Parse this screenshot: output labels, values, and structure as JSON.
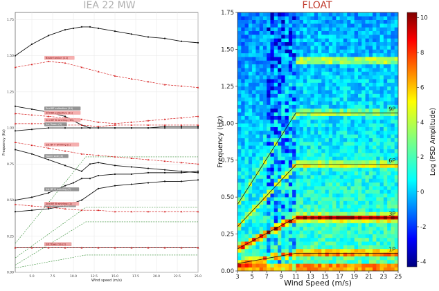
{
  "left_title": "IEA 22 MW",
  "right_title": "FLOAT",
  "left_title_color": "#b0b0b0",
  "right_title_color": "#c0392b",
  "left": {
    "xlabel": "Wind speed (m/s)",
    "ylabel": "Frequency (Hz)",
    "xlim": [
      3,
      25
    ],
    "ylim": [
      0.0,
      1.8
    ],
    "xticks": [
      "5.0",
      "7.5",
      "10.0",
      "12.5",
      "15.0",
      "17.5",
      "20.0",
      "22.5",
      "25.0"
    ],
    "yticks": [
      "0.00",
      "0.25",
      "0.50",
      "0.75",
      "1.00",
      "1.25",
      "1.50",
      "1.75"
    ]
  },
  "right": {
    "xlabel": "Wind Speed (m/s)",
    "ylabel": "Frequency (Hz)",
    "colorbar_label": "Log (PSD Amplitude)",
    "xlim": [
      3,
      25
    ],
    "ylim": [
      0.0,
      1.75
    ],
    "xticks": [
      "3",
      "5",
      "7",
      "9",
      "11",
      "13",
      "15",
      "17",
      "19",
      "21",
      "23",
      "25"
    ],
    "yticks": [
      "0.00",
      "0.25",
      "0.50",
      "0.75",
      "1.00",
      "1.25",
      "1.50",
      "1.75"
    ],
    "cbar_ticks": [
      "-4",
      "-2",
      "0",
      "2",
      "4",
      "6",
      "8",
      "10"
    ],
    "harmonic_labels": [
      "9P",
      "6P",
      "3P",
      "1P"
    ]
  },
  "chart_data": [
    {
      "type": "line",
      "title": "IEA 22 MW",
      "xlabel": "Wind speed (m/s)",
      "ylabel": "Frequency (Hz)",
      "xlim": [
        3,
        25
      ],
      "ylim": [
        0.0,
        1.8
      ],
      "series": [
        {
          "name": "",
          "style": "black",
          "x": [
            3,
            5,
            7,
            9,
            10,
            11,
            12,
            13,
            15,
            17,
            19,
            21,
            23,
            25
          ],
          "y": [
            1.5,
            1.58,
            1.64,
            1.68,
            1.69,
            1.7,
            1.7,
            1.69,
            1.67,
            1.65,
            1.63,
            1.62,
            1.6,
            1.59
          ]
        },
        {
          "name": "Blade torsion (12)",
          "style": "red",
          "x": [
            3,
            5,
            7,
            9,
            11,
            13,
            15,
            17,
            19,
            21,
            23,
            25
          ],
          "y": [
            1.42,
            1.44,
            1.46,
            1.45,
            1.42,
            1.39,
            1.36,
            1.34,
            1.32,
            1.3,
            1.29,
            1.28
          ]
        },
        {
          "name": "2nd BF collective (10)",
          "style": "black",
          "x": [
            3,
            5,
            7,
            9,
            10,
            11,
            12,
            13,
            15,
            17,
            19,
            21,
            23,
            25
          ],
          "y": [
            1.15,
            1.13,
            1.11,
            1.08,
            1.05,
            1.02,
            1.0,
            1.0,
            1.0,
            1.0,
            1.0,
            1.0,
            1.0,
            1.0
          ]
        },
        {
          "name": "2nd BF collective (11)",
          "style": "red",
          "x": [
            3,
            5,
            7,
            9,
            11,
            13,
            15,
            17,
            19,
            21,
            23,
            25
          ],
          "y": [
            1.1,
            1.09,
            1.08,
            1.07,
            1.06,
            1.04,
            1.03,
            1.04,
            1.05,
            1.06,
            1.07,
            1.08
          ]
        },
        {
          "name": "2nd BF B whirling (10)",
          "style": "red",
          "x": [
            3,
            5,
            7,
            9,
            11,
            13,
            15,
            17,
            19,
            21,
            23,
            25
          ],
          "y": [
            1.03,
            1.03,
            1.03,
            1.02,
            1.02,
            1.01,
            1.02,
            1.02,
            1.02,
            1.02,
            1.02,
            1.02
          ]
        },
        {
          "name": "1st Tower (9)",
          "style": "black",
          "x": [
            3,
            5,
            7,
            9,
            11,
            13,
            15,
            17,
            19,
            21,
            23,
            25
          ],
          "y": [
            0.98,
            0.99,
            1.0,
            1.0,
            1.0,
            1.0,
            1.0,
            1.0,
            1.0,
            1.01,
            1.01,
            1.01
          ]
        },
        {
          "name": "1st BF F whirling (1)",
          "style": "red",
          "x": [
            3,
            5,
            7,
            9,
            11,
            13,
            15,
            17,
            19,
            21,
            23,
            25
          ],
          "y": [
            0.9,
            0.88,
            0.86,
            0.84,
            0.82,
            0.81,
            0.8,
            0.79,
            0.78,
            0.77,
            0.76,
            0.75
          ]
        },
        {
          "name": "Tower side (8)",
          "style": "black",
          "x": [
            3,
            5,
            7,
            9,
            11,
            12,
            13,
            15,
            17,
            19,
            21,
            23,
            25
          ],
          "y": [
            0.85,
            0.82,
            0.78,
            0.74,
            0.7,
            0.75,
            0.76,
            0.74,
            0.73,
            0.72,
            0.71,
            0.7,
            0.69
          ]
        },
        {
          "name": "1st BF B whirling (7)",
          "style": "black",
          "x": [
            3,
            5,
            7,
            9,
            10,
            11,
            12,
            13,
            15,
            17,
            19,
            21,
            23,
            25
          ],
          "y": [
            0.5,
            0.52,
            0.55,
            0.6,
            0.62,
            0.65,
            0.65,
            0.67,
            0.68,
            0.68,
            0.69,
            0.69,
            0.69,
            0.7
          ]
        },
        {
          "name": "1st BF flapping (2)",
          "style": "black",
          "x": [
            3,
            5,
            7,
            9,
            11,
            13,
            15,
            17,
            19,
            21,
            23,
            25
          ],
          "y": [
            0.42,
            0.43,
            0.44,
            0.46,
            0.5,
            0.58,
            0.6,
            0.61,
            0.62,
            0.63,
            0.63,
            0.64
          ]
        },
        {
          "name": "2nd BF B whirling (1)",
          "style": "red",
          "x": [
            3,
            5,
            7,
            9,
            11,
            13,
            15,
            17,
            19,
            21,
            23,
            25
          ],
          "y": [
            0.47,
            0.46,
            0.45,
            0.44,
            0.43,
            0.43,
            0.42,
            0.42,
            0.42,
            0.42,
            0.42,
            0.42
          ]
        },
        {
          "name": "1st Tower FA (1)",
          "style": "black",
          "x": [
            3,
            5,
            7,
            9,
            11,
            13,
            15,
            17,
            19,
            21,
            23,
            25
          ],
          "y": [
            0.17,
            0.17,
            0.17,
            0.17,
            0.17,
            0.17,
            0.17,
            0.17,
            0.17,
            0.17,
            0.17,
            0.17
          ]
        },
        {
          "name": "1st Tower SS (2)",
          "style": "red",
          "x": [
            3,
            5,
            7,
            9,
            11,
            13,
            15,
            17,
            19,
            21,
            23,
            25
          ],
          "y": [
            0.17,
            0.17,
            0.17,
            0.17,
            0.17,
            0.17,
            0.17,
            0.17,
            0.17,
            0.17,
            0.17,
            0.17
          ]
        }
      ]
    },
    {
      "type": "heatmap",
      "title": "FLOAT",
      "xlabel": "Wind Speed (m/s)",
      "ylabel": "Frequency (Hz)",
      "colorbar_label": "Log (PSD Amplitude)",
      "xlim": [
        3,
        25
      ],
      "ylim": [
        0.0,
        1.75
      ],
      "zlim": [
        -4,
        10
      ],
      "harmonics": [
        {
          "name": "1P",
          "x": [
            3,
            11,
            25
          ],
          "y": [
            0.05,
            0.12,
            0.12
          ]
        },
        {
          "name": "3P",
          "x": [
            3,
            11,
            25
          ],
          "y": [
            0.15,
            0.36,
            0.36
          ]
        },
        {
          "name": "6P",
          "x": [
            3,
            11,
            25
          ],
          "y": [
            0.3,
            0.72,
            0.72
          ]
        },
        {
          "name": "9P",
          "x": [
            3,
            11,
            25
          ],
          "y": [
            0.45,
            1.07,
            1.07
          ]
        }
      ]
    }
  ]
}
